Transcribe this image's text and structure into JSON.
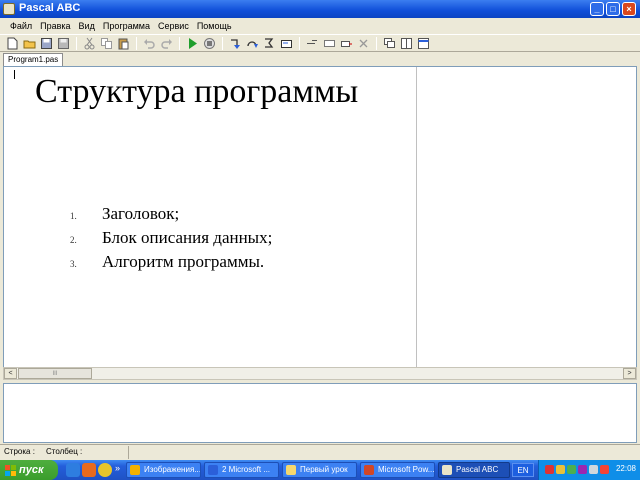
{
  "window": {
    "title": "Pascal ABC",
    "minimize_glyph": "_",
    "maximize_glyph": "□",
    "close_glyph": "×"
  },
  "menu": [
    "Файл",
    "Правка",
    "Вид",
    "Программа",
    "Сервис",
    "Помощь"
  ],
  "toolbar": {
    "groups": [
      [
        "new-file-icon",
        "open-folder-icon",
        "save-icon",
        "save-all-icon"
      ],
      [
        "cut-icon",
        "copy-icon",
        "paste-icon"
      ],
      [
        "undo-icon",
        "redo-icon"
      ],
      [
        "run-icon",
        "stop-icon"
      ],
      [
        "step-into-icon",
        "step-over-icon",
        "run-to-cursor-icon",
        "watch-icon"
      ],
      [
        "add-watch-icon",
        "breakpoint-icon",
        "clear-output-icon",
        "close-icon"
      ],
      [
        "window-cascade-icon",
        "window-tile-icon",
        "window-icon"
      ]
    ]
  },
  "tabs": [
    {
      "label": "Program1.pas",
      "active": true
    }
  ],
  "document": {
    "title": "Структура программы",
    "items": [
      {
        "num": "1.",
        "text": "Заголовок;"
      },
      {
        "num": "2.",
        "text": "Блок описания данных;"
      },
      {
        "num": "3.",
        "text": "Алгоритм программы."
      }
    ]
  },
  "scrollbar": {
    "left_glyph": "<",
    "right_glyph": ">",
    "grip_glyph": "III"
  },
  "statusbar": {
    "position_label": "Строка :",
    "column_label": "Столбец :"
  },
  "taskbar": {
    "start_label": "пуск",
    "quicklaunch": [
      "ie-icon",
      "firefox-icon",
      "chrome-icon"
    ],
    "more_glyph": "»",
    "tasks": [
      {
        "label": "Изображения...",
        "icon_color": "#f2b100",
        "active": false
      },
      {
        "label": "2 Microsoft ...",
        "icon_color": "#2b5fd9",
        "active": false
      },
      {
        "label": "Первый урок",
        "icon_color": "#f5d76e",
        "active": false
      },
      {
        "label": "Microsoft Pow...",
        "icon_color": "#d24726",
        "active": false
      },
      {
        "label": "Pascal ABC",
        "icon_color": "#e9e4c8",
        "active": true
      }
    ],
    "language": "EN",
    "clock": "22:08"
  },
  "colors": {
    "titlebar": "#0f4ed8",
    "taskbar": "#245edb",
    "start": "#3a9d2c",
    "tray": "#0f8ee8"
  }
}
